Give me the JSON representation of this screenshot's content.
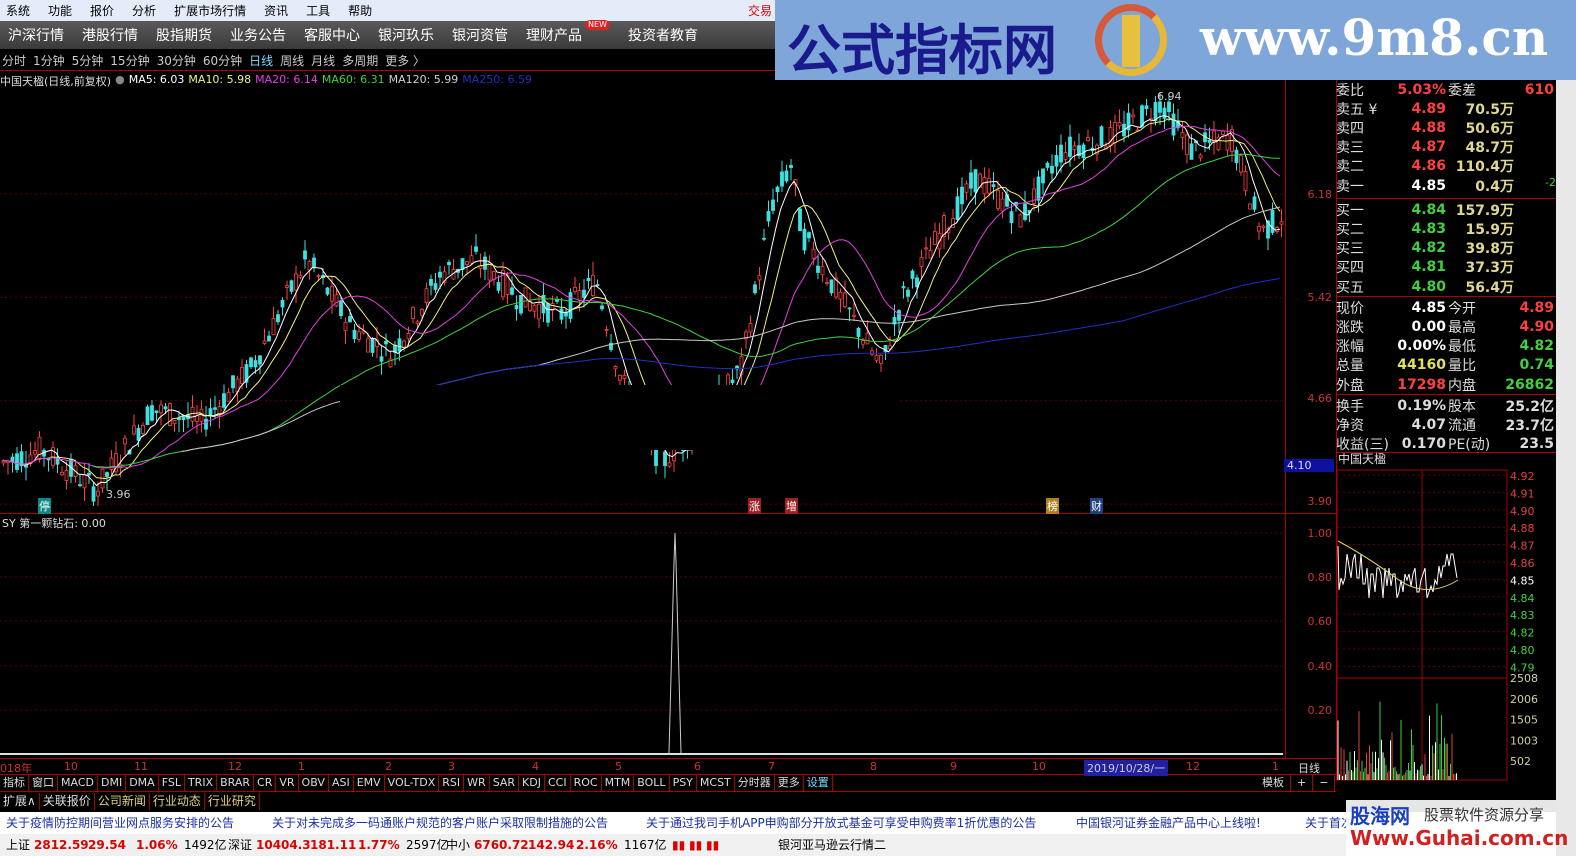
{
  "menu": {
    "items": [
      "系统",
      "功能",
      "报价",
      "分析",
      "扩展市场行情",
      "资讯",
      "工具",
      "帮助"
    ],
    "trade": "交易"
  },
  "nav": {
    "items": [
      "沪深行情",
      "港股行情",
      "股指期货",
      "业务公告",
      "客服中心",
      "银河玖乐",
      "银河资管",
      "理财产品",
      "投资者教育"
    ],
    "new_badge": "NEW"
  },
  "periods": {
    "items": [
      "分时",
      "1分钟",
      "5分钟",
      "15分钟",
      "30分钟",
      "60分钟",
      "日线",
      "周线",
      "月线",
      "多周期",
      "更多 〉"
    ],
    "active": "日线"
  },
  "title": {
    "stock": "中国天楹(日线,前复权)",
    "ma": [
      {
        "label": "MA5: 6.03",
        "color": "#ffffff"
      },
      {
        "label": "MA10: 5.98",
        "color": "#f0f080"
      },
      {
        "label": "MA20: 6.14",
        "color": "#e040e0"
      },
      {
        "label": "MA60: 6.31",
        "color": "#40d040"
      },
      {
        "label": "MA120: 5.99",
        "color": "#d0d0d0"
      },
      {
        "label": "MA250: 6.59",
        "color": "#2030c0"
      }
    ]
  },
  "watermark": {
    "text": "公式指标网",
    "url": "www.9m8.cn"
  },
  "kline": {
    "high_label": "6.94",
    "low_label": "3.96",
    "price_axis": [
      "6.18",
      "5.42",
      "4.66",
      "4.10",
      "3.90"
    ],
    "markers": [
      "停",
      "涨",
      "增",
      "榜",
      "财"
    ],
    "colors": {
      "up": "#ff4040",
      "down": "#40e0e0"
    }
  },
  "indicator": {
    "label": "SY 第一颗钻石: 0.00",
    "axis": [
      "1.00",
      "0.80",
      "0.60",
      "0.40",
      "0.20"
    ]
  },
  "quote": {
    "wb": {
      "k": "委比",
      "v": "5.03%",
      "k2": "委差",
      "v2": "610"
    },
    "asks": [
      {
        "k": "卖五 ¥",
        "p": "4.89",
        "q": "70.5万"
      },
      {
        "k": "卖四",
        "p": "4.88",
        "q": "50.6万"
      },
      {
        "k": "卖三",
        "p": "4.87",
        "q": "48.7万"
      },
      {
        "k": "卖二",
        "p": "4.86",
        "q": "110.4万"
      },
      {
        "k": "卖一",
        "p": "4.85",
        "q": "0.4万",
        "x": "-2"
      }
    ],
    "bids": [
      {
        "k": "买一",
        "p": "4.84",
        "q": "157.9万"
      },
      {
        "k": "买二",
        "p": "4.83",
        "q": "15.9万"
      },
      {
        "k": "买三",
        "p": "4.82",
        "q": "39.8万"
      },
      {
        "k": "买四",
        "p": "4.81",
        "q": "37.3万"
      },
      {
        "k": "买五",
        "p": "4.80",
        "q": "56.4万"
      }
    ],
    "stats": [
      {
        "k": "现价",
        "v": "4.85",
        "c": "#fff",
        "k2": "今开",
        "v2": "4.89",
        "c2": "#ff4040"
      },
      {
        "k": "涨跌",
        "v": "0.00",
        "c": "#fff",
        "k2": "最高",
        "v2": "4.90",
        "c2": "#ff4040"
      },
      {
        "k": "涨幅",
        "v": "0.00%",
        "c": "#fff",
        "k2": "最低",
        "v2": "4.82",
        "c2": "#40d040"
      },
      {
        "k": "总量",
        "v": "44160",
        "c": "#e0e060",
        "k2": "量比",
        "v2": "0.74",
        "c2": "#40d040"
      },
      {
        "k": "外盘",
        "v": "17298",
        "c": "#ff4040",
        "k2": "内盘",
        "v2": "26862",
        "c2": "#40d040"
      }
    ],
    "fund": [
      {
        "k": "换手",
        "v": "0.19%",
        "k2": "股本",
        "v2": "25.2亿"
      },
      {
        "k": "净资",
        "v": "4.07",
        "k2": "流通",
        "v2": "23.7亿"
      },
      {
        "k": "收益(三)",
        "v": "0.170",
        "k2": "PE(动)",
        "v2": "23.5"
      }
    ]
  },
  "mini": {
    "name": "中国天楹",
    "price_axis": [
      "4.92",
      "4.91",
      "4.90",
      "4.88",
      "4.87",
      "4.86",
      "4.85",
      "4.84",
      "4.83",
      "4.82",
      "4.80",
      "4.79"
    ],
    "vol_axis": [
      "2508",
      "2006",
      "1505",
      "1003",
      "502"
    ]
  },
  "dates": {
    "items": [
      "018年",
      "10",
      "11",
      "12",
      "1",
      "2",
      "3",
      "4",
      "5",
      "6",
      "7",
      "8",
      "9",
      "10",
      "2019/10/28/一",
      "12",
      "1"
    ],
    "period": "日线"
  },
  "tabs": [
    "指标",
    "窗口",
    "MACD",
    "DMI",
    "DMA",
    "FSL",
    "TRIX",
    "BRAR",
    "CR",
    "VR",
    "OBV",
    "ASI",
    "EMV",
    "VOL-TDX",
    "RSI",
    "WR",
    "SAR",
    "KDJ",
    "CCI",
    "ROC",
    "MTM",
    "BOLL",
    "PSY",
    "MCST",
    "分时器",
    "更多",
    "设置"
  ],
  "tab_right": [
    "模板",
    "+",
    "−"
  ],
  "ext": [
    "扩展∧",
    "关联报价",
    "公司新闻",
    "行业动态",
    "行业研究"
  ],
  "news": [
    "关于疫情防控期间营业网点服务安排的公告",
    "关于对未完成多一码通账户规范的客户账户采取限制措施的公告",
    "关于通过我司手机APP申购部分开放式基金可享受申购费率1折优惠的公告",
    "中国银河证券金融产品中心上线啦!",
    "关于首次"
  ],
  "status": {
    "sh": [
      "上证",
      "2812.59",
      "29.54",
      "1.06%",
      "1492亿"
    ],
    "sz": [
      "深证",
      "10404.3",
      "181.11",
      "1.77%",
      "2597亿"
    ],
    "zx": [
      "中小",
      "6760.72",
      "142.94",
      "2.16%",
      "1167亿"
    ],
    "tail": "银河亚马逊云行情二"
  },
  "guhai": {
    "name": "股海网",
    "slogan": "股票软件资源分享",
    "url": "Www.Guhai.com.cn"
  }
}
